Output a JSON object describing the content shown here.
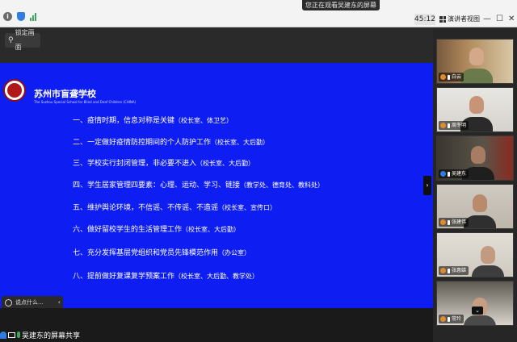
{
  "topbar": {
    "share_banner": "您正在观看吴建东的屏幕",
    "timer": "45:12",
    "view_label": "演讲者视图",
    "window_controls": [
      "—",
      "☐",
      "✕"
    ]
  },
  "toolbar": {
    "pin_label": "锁定画面"
  },
  "slide": {
    "school_name": "苏州市盲聋学校",
    "school_subtitle": "The Suzhou Special School for Blind and Deaf Children (CHINA)",
    "items": [
      {
        "text": "一、疫情时期，信息对称是关键",
        "note": "（校长室、体卫艺）"
      },
      {
        "text": "二、一定做好疫情防控期间的个人防护工作",
        "note": "（校长室、大后勤）"
      },
      {
        "text": "三、学校实行封闭管理，非必要不进入",
        "note": "（校长室、大后勤）"
      },
      {
        "text": "四、学生居家管理四要素：心理、运动、学习、链接",
        "note": "（教学处、德育处、教科处）"
      },
      {
        "text": "五、维护舆论环境，不信谣、不传谣、不造谣",
        "note": "（校长室、宣传口）"
      },
      {
        "text": "六、做好留校学生的生活管理工作",
        "note": "（校长室、大后勤）"
      },
      {
        "text": "七、充分发挥基层党组织和党员先锋模范作用",
        "note": "（办公室）"
      },
      {
        "text": "八、提前做好复课复学预案工作",
        "note": "（校长室、大后勤、教学处）"
      }
    ]
  },
  "comment": {
    "placeholder": "说点什么..."
  },
  "screen_share": {
    "label": "吴建东的屏幕共享"
  },
  "participants": [
    {
      "name": "白云"
    },
    {
      "name": "周冬明"
    },
    {
      "name": "吴建东"
    },
    {
      "name": "张建伟"
    },
    {
      "name": "张惠娣"
    },
    {
      "name": "常玲"
    }
  ],
  "colors": {
    "slide_bg": "#0e1ef2",
    "logo_red": "#b0181a"
  }
}
